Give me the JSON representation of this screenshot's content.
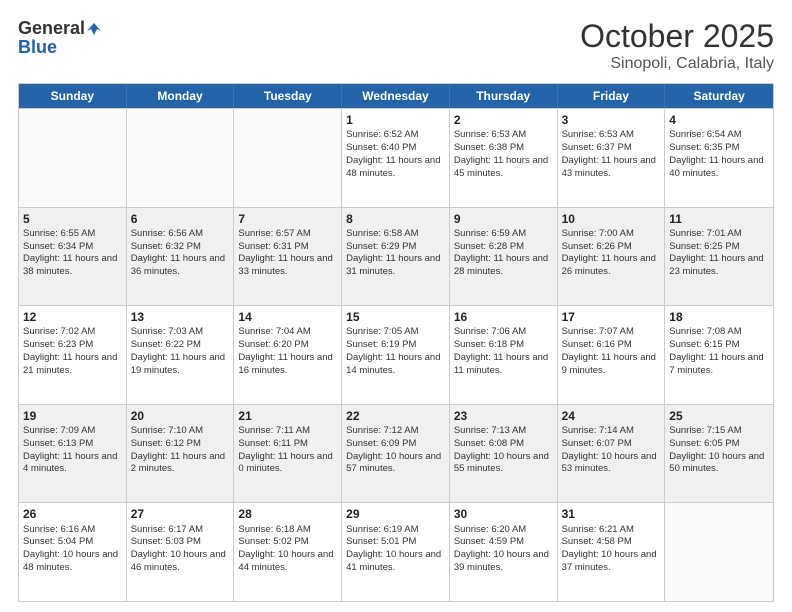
{
  "header": {
    "logo_general": "General",
    "logo_blue": "Blue",
    "month_title": "October 2025",
    "subtitle": "Sinopoli, Calabria, Italy"
  },
  "days_of_week": [
    "Sunday",
    "Monday",
    "Tuesday",
    "Wednesday",
    "Thursday",
    "Friday",
    "Saturday"
  ],
  "rows": [
    [
      {
        "day": "",
        "text": "",
        "empty": true
      },
      {
        "day": "",
        "text": "",
        "empty": true
      },
      {
        "day": "",
        "text": "",
        "empty": true
      },
      {
        "day": "1",
        "text": "Sunrise: 6:52 AM\nSunset: 6:40 PM\nDaylight: 11 hours and 48 minutes."
      },
      {
        "day": "2",
        "text": "Sunrise: 6:53 AM\nSunset: 6:38 PM\nDaylight: 11 hours and 45 minutes."
      },
      {
        "day": "3",
        "text": "Sunrise: 6:53 AM\nSunset: 6:37 PM\nDaylight: 11 hours and 43 minutes."
      },
      {
        "day": "4",
        "text": "Sunrise: 6:54 AM\nSunset: 6:35 PM\nDaylight: 11 hours and 40 minutes."
      }
    ],
    [
      {
        "day": "5",
        "text": "Sunrise: 6:55 AM\nSunset: 6:34 PM\nDaylight: 11 hours and 38 minutes."
      },
      {
        "day": "6",
        "text": "Sunrise: 6:56 AM\nSunset: 6:32 PM\nDaylight: 11 hours and 36 minutes."
      },
      {
        "day": "7",
        "text": "Sunrise: 6:57 AM\nSunset: 6:31 PM\nDaylight: 11 hours and 33 minutes."
      },
      {
        "day": "8",
        "text": "Sunrise: 6:58 AM\nSunset: 6:29 PM\nDaylight: 11 hours and 31 minutes."
      },
      {
        "day": "9",
        "text": "Sunrise: 6:59 AM\nSunset: 6:28 PM\nDaylight: 11 hours and 28 minutes."
      },
      {
        "day": "10",
        "text": "Sunrise: 7:00 AM\nSunset: 6:26 PM\nDaylight: 11 hours and 26 minutes."
      },
      {
        "day": "11",
        "text": "Sunrise: 7:01 AM\nSunset: 6:25 PM\nDaylight: 11 hours and 23 minutes."
      }
    ],
    [
      {
        "day": "12",
        "text": "Sunrise: 7:02 AM\nSunset: 6:23 PM\nDaylight: 11 hours and 21 minutes."
      },
      {
        "day": "13",
        "text": "Sunrise: 7:03 AM\nSunset: 6:22 PM\nDaylight: 11 hours and 19 minutes."
      },
      {
        "day": "14",
        "text": "Sunrise: 7:04 AM\nSunset: 6:20 PM\nDaylight: 11 hours and 16 minutes."
      },
      {
        "day": "15",
        "text": "Sunrise: 7:05 AM\nSunset: 6:19 PM\nDaylight: 11 hours and 14 minutes."
      },
      {
        "day": "16",
        "text": "Sunrise: 7:06 AM\nSunset: 6:18 PM\nDaylight: 11 hours and 11 minutes."
      },
      {
        "day": "17",
        "text": "Sunrise: 7:07 AM\nSunset: 6:16 PM\nDaylight: 11 hours and 9 minutes."
      },
      {
        "day": "18",
        "text": "Sunrise: 7:08 AM\nSunset: 6:15 PM\nDaylight: 11 hours and 7 minutes."
      }
    ],
    [
      {
        "day": "19",
        "text": "Sunrise: 7:09 AM\nSunset: 6:13 PM\nDaylight: 11 hours and 4 minutes."
      },
      {
        "day": "20",
        "text": "Sunrise: 7:10 AM\nSunset: 6:12 PM\nDaylight: 11 hours and 2 minutes."
      },
      {
        "day": "21",
        "text": "Sunrise: 7:11 AM\nSunset: 6:11 PM\nDaylight: 11 hours and 0 minutes."
      },
      {
        "day": "22",
        "text": "Sunrise: 7:12 AM\nSunset: 6:09 PM\nDaylight: 10 hours and 57 minutes."
      },
      {
        "day": "23",
        "text": "Sunrise: 7:13 AM\nSunset: 6:08 PM\nDaylight: 10 hours and 55 minutes."
      },
      {
        "day": "24",
        "text": "Sunrise: 7:14 AM\nSunset: 6:07 PM\nDaylight: 10 hours and 53 minutes."
      },
      {
        "day": "25",
        "text": "Sunrise: 7:15 AM\nSunset: 6:05 PM\nDaylight: 10 hours and 50 minutes."
      }
    ],
    [
      {
        "day": "26",
        "text": "Sunrise: 6:16 AM\nSunset: 5:04 PM\nDaylight: 10 hours and 48 minutes."
      },
      {
        "day": "27",
        "text": "Sunrise: 6:17 AM\nSunset: 5:03 PM\nDaylight: 10 hours and 46 minutes."
      },
      {
        "day": "28",
        "text": "Sunrise: 6:18 AM\nSunset: 5:02 PM\nDaylight: 10 hours and 44 minutes."
      },
      {
        "day": "29",
        "text": "Sunrise: 6:19 AM\nSunset: 5:01 PM\nDaylight: 10 hours and 41 minutes."
      },
      {
        "day": "30",
        "text": "Sunrise: 6:20 AM\nSunset: 4:59 PM\nDaylight: 10 hours and 39 minutes."
      },
      {
        "day": "31",
        "text": "Sunrise: 6:21 AM\nSunset: 4:58 PM\nDaylight: 10 hours and 37 minutes."
      },
      {
        "day": "",
        "text": "",
        "empty": true
      }
    ]
  ]
}
